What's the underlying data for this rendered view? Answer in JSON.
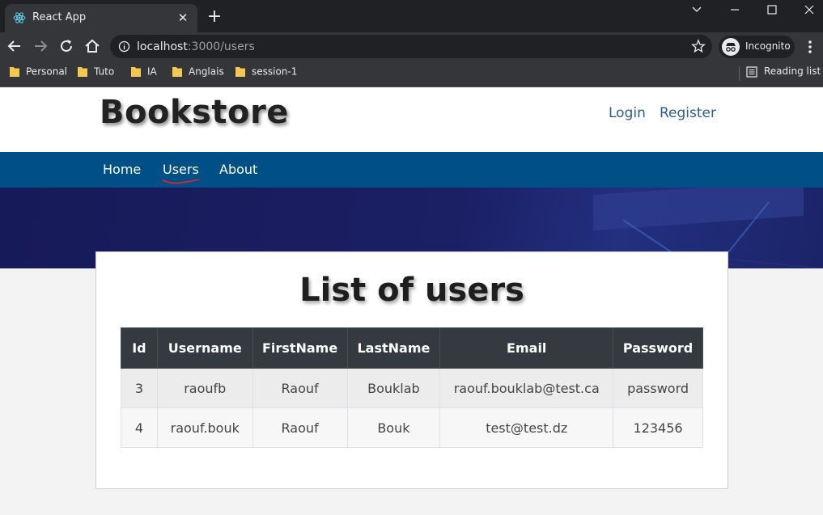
{
  "browser": {
    "tab_title": "React App",
    "url_host": "localhost",
    "url_rest": ":3000/users",
    "profile_label": "Incognito",
    "bookmarks": [
      "Personal",
      "Tuto",
      "IA",
      "Anglais",
      "session-1"
    ],
    "reading_list_label": "Reading list"
  },
  "site": {
    "brand": "Bookstore",
    "login_label": "Login",
    "register_label": "Register",
    "nav": [
      "Home",
      "Users",
      "About"
    ],
    "active_nav": "Users"
  },
  "main": {
    "title": "List of users",
    "table": {
      "headers": [
        "Id",
        "Username",
        "FirstName",
        "LastName",
        "Email",
        "Password"
      ],
      "rows": [
        [
          "3",
          "raoufb",
          "Raouf",
          "Bouklab",
          "raouf.bouklab@test.ca",
          "password"
        ],
        [
          "4",
          "raouf.bouk",
          "Raouf",
          "Bouk",
          "test@test.dz",
          "123456"
        ]
      ]
    }
  },
  "colors": {
    "navbar": "#004f86",
    "table_header": "#343a40",
    "link": "#2a5d92"
  }
}
